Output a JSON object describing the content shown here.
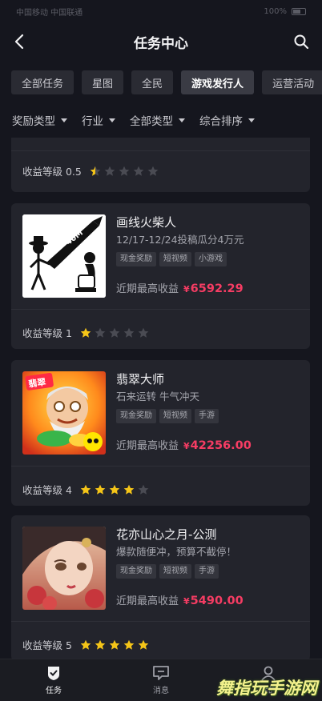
{
  "status_bar": {
    "left": "中国移动 中国联通",
    "right": "100%"
  },
  "header": {
    "title": "任务中心"
  },
  "tabs": [
    {
      "label": "全部任务"
    },
    {
      "label": "星图"
    },
    {
      "label": "全民"
    },
    {
      "label": "游戏发行人",
      "active": true
    },
    {
      "label": "运营活动"
    }
  ],
  "filters": [
    {
      "label": "奖励类型"
    },
    {
      "label": "行业"
    },
    {
      "label": "全部类型"
    },
    {
      "label": "综合排序"
    }
  ],
  "partial_card": {
    "level_label": "收益等级 0.5",
    "rating": 0.5
  },
  "cards": [
    {
      "name": "画线火柴人",
      "desc": "12/17-12/24投稿瓜分4万元",
      "tags": [
        "现金奖励",
        "短视频",
        "小游戏"
      ],
      "earn_label": "近期最高收益",
      "currency": "¥",
      "amount": "6592.29",
      "level_label": "收益等级 1",
      "rating": 1,
      "thumb_text": "40M"
    },
    {
      "name": "翡翠大师",
      "desc": "石来运转 牛气冲天",
      "tags": [
        "现金奖励",
        "短视频",
        "手游"
      ],
      "earn_label": "近期最高收益",
      "currency": "¥",
      "amount": "42256.00",
      "level_label": "收益等级 4",
      "rating": 4,
      "thumb_text": "翡翠"
    },
    {
      "name": "花亦山心之月-公测",
      "desc": "爆款随便冲，预算不截停！",
      "tags": [
        "现金奖励",
        "短视频",
        "手游"
      ],
      "earn_label": "近期最高收益",
      "currency": "¥",
      "amount": "5490.00",
      "level_label": "收益等级 5",
      "rating": 5
    }
  ],
  "tab_bar": [
    {
      "label": "任务",
      "icon": "task-shield-icon",
      "active": true
    },
    {
      "label": "消息",
      "icon": "message-icon"
    },
    {
      "label": "我的",
      "icon": "profile-icon"
    }
  ],
  "watermark": "舞指玩手游网",
  "colors": {
    "background": "#15161e",
    "card": "#23242c",
    "accent_red": "#f53c63",
    "star": "#f5c518"
  }
}
